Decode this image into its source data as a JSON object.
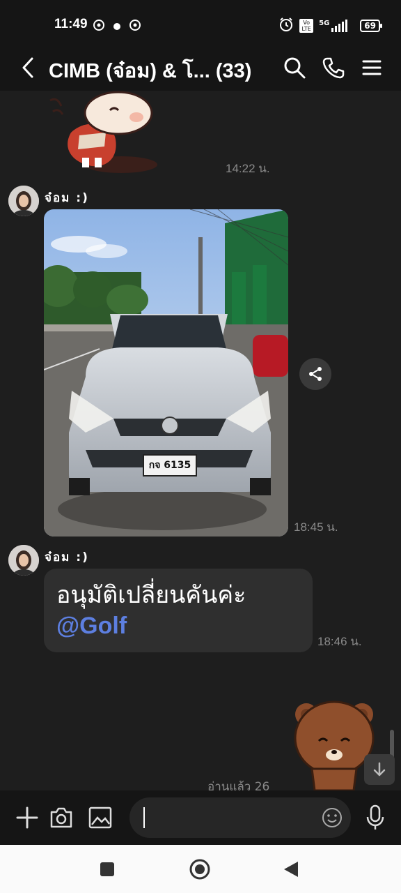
{
  "status_bar": {
    "time": "11:49",
    "network": "5G",
    "volte": "Vo LTE",
    "battery": "69"
  },
  "header": {
    "title": "CIMB (จ๋อม) & โ... (33)"
  },
  "messages": [
    {
      "type": "sticker",
      "time": "14:22 น."
    },
    {
      "type": "image",
      "sender": "จ๋อม :)",
      "time": "18:45 น.",
      "plate": "กจ 6135"
    },
    {
      "type": "text",
      "sender": "จ๋อม :)",
      "text": "อนุมัติเปลี่ยนคันค่ะ",
      "mention": "@Golf",
      "time": "18:46 น."
    },
    {
      "type": "sticker",
      "read_receipt": "อ่านแล้ว 26"
    }
  ],
  "colors": {
    "background": "#1e1e1e",
    "bubble": "#2f2f2f",
    "mention": "#5d7fe0",
    "timestamp": "#8a8a8a"
  },
  "icons": [
    "back-icon",
    "search-icon",
    "phone-icon",
    "menu-icon",
    "share-icon",
    "arrow-down-icon",
    "plus-icon",
    "camera-icon",
    "image-icon",
    "emoji-icon",
    "mic-icon",
    "nav-recents-icon",
    "nav-home-icon",
    "nav-back-icon"
  ]
}
